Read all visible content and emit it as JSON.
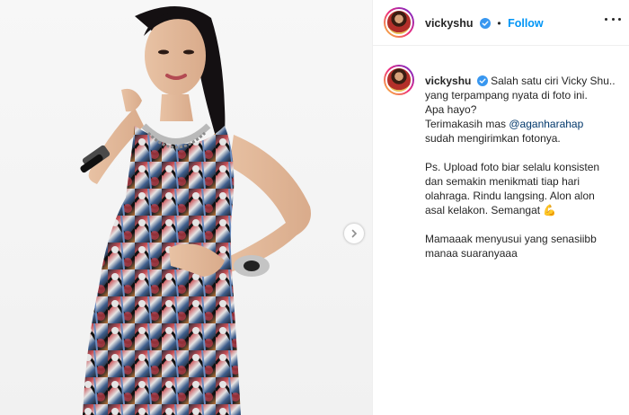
{
  "header": {
    "username": "vickyshu",
    "separator": "•",
    "follow_label": "Follow"
  },
  "caption": {
    "username": "vickyshu",
    "line1": "Salah satu ciri Vicky Shu..",
    "line2": "yang terpampang nyata di foto ini.",
    "line3": "Apa hayo?",
    "line4": "Terimakasih mas ",
    "mention": "@aganharahap",
    "line5": "sudah mengirimkan fotonya.",
    "line6": "Ps. Upload foto biar selalu konsisten",
    "line7": "dan semakin menikmati tiap hari",
    "line8": "olahraga. Rindu langsing. Alon alon",
    "line9": "asal kelakon. Semangat ",
    "emoji": "💪",
    "line10": "Mamaaak menyusui yang senasiibb",
    "line11": "manaa suaranyaaa"
  },
  "colors": {
    "follow": "#0095f6",
    "mention": "#00376b",
    "verified": "#3897f0",
    "text": "#262626"
  },
  "icons": {
    "verified": "verified-badge-icon",
    "next": "chevron-right-icon",
    "more": "more-options-icon"
  }
}
